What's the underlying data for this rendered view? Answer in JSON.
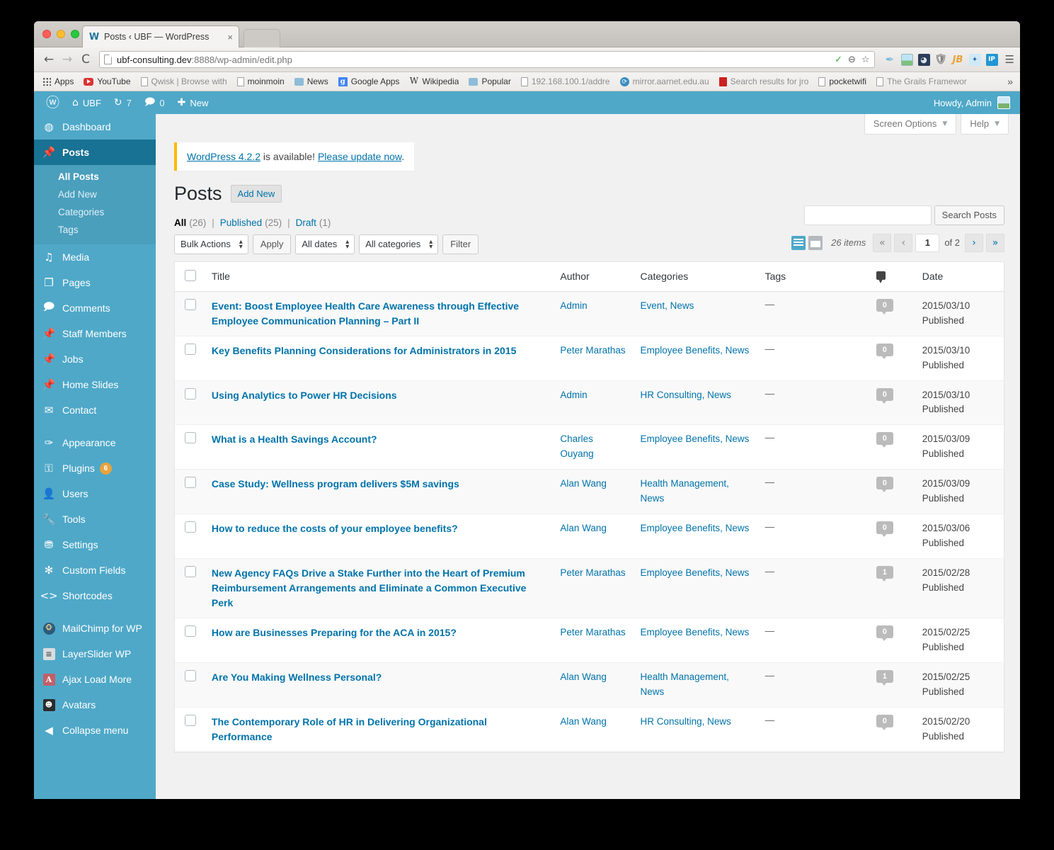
{
  "browser": {
    "tab": {
      "title": "Posts ‹ UBF — WordPress",
      "favicon": "wordpress-icon",
      "close": "×"
    },
    "nav": {
      "back": "←",
      "forward": "→",
      "reload": "C"
    },
    "url": {
      "host": "ubf-consulting.dev",
      "rest": ":8888/wp-admin/edit.php"
    },
    "omnibox_icons": [
      "check-icon",
      "zoom-out-icon",
      "bookmark-star-icon"
    ],
    "extension_icons": [
      "feather-icon",
      "image-icon",
      "speedometer-icon",
      "shield-icon",
      "jb-icon",
      "gear-tag-icon",
      "ip-icon",
      "chrome-menu-icon"
    ],
    "bookmarks": [
      {
        "label": "Apps",
        "icon": "apps-grid-icon"
      },
      {
        "label": "YouTube",
        "icon": "youtube-icon"
      },
      {
        "label": "Qwisk | Browse with",
        "icon": "page-icon"
      },
      {
        "label": "moinmoin",
        "icon": "page-icon"
      },
      {
        "label": "News",
        "icon": "folder-icon"
      },
      {
        "label": "Google Apps",
        "icon": "google-icon"
      },
      {
        "label": "Wikipedia",
        "icon": "wikipedia-icon"
      },
      {
        "label": "Popular",
        "icon": "folder-icon"
      },
      {
        "label": "192.168.100.1/addre",
        "icon": "page-icon"
      },
      {
        "label": "mirror.aarnet.edu.au",
        "icon": "mirror-icon"
      },
      {
        "label": "Search results for jro",
        "icon": "red-icon"
      },
      {
        "label": "pocketwifi",
        "icon": "page-icon"
      },
      {
        "label": "The Grails Framewor",
        "icon": "page-icon"
      }
    ],
    "bookmarks_overflow": "»"
  },
  "adminbar": {
    "logo": "wordpress-logo-icon",
    "site_name": "UBF",
    "site_icon": "home-icon",
    "updates_icon": "updates-icon",
    "updates_count": "7",
    "comments_icon": "comment-icon",
    "comments_count": "0",
    "new_icon": "plus-icon",
    "new_label": "New",
    "howdy": "Howdy, Admin",
    "avatar": "avatar"
  },
  "sidebar": {
    "items": [
      {
        "label": "Dashboard",
        "icon": "dashboard-icon",
        "glyph": "◔"
      },
      {
        "label": "Posts",
        "icon": "pin-icon",
        "glyph": "📌",
        "current": true
      },
      {
        "label": "Media",
        "icon": "media-icon",
        "glyph": "♫"
      },
      {
        "label": "Pages",
        "icon": "pages-icon",
        "glyph": "❐"
      },
      {
        "label": "Comments",
        "icon": "comments-icon",
        "glyph": "🗩"
      },
      {
        "label": "Staff Members",
        "icon": "pin-icon",
        "glyph": "📌"
      },
      {
        "label": "Jobs",
        "icon": "pin-icon",
        "glyph": "📌"
      },
      {
        "label": "Home Slides",
        "icon": "pin-icon",
        "glyph": "📌"
      },
      {
        "label": "Contact",
        "icon": "mail-icon",
        "glyph": "✉"
      },
      {
        "label": "Appearance",
        "icon": "appearance-brush-icon",
        "glyph": "🖌"
      },
      {
        "label": "Plugins",
        "icon": "plugin-icon",
        "glyph": "🔌",
        "badge": "6"
      },
      {
        "label": "Users",
        "icon": "user-icon",
        "glyph": "👤"
      },
      {
        "label": "Tools",
        "icon": "tools-wrench-icon",
        "glyph": "🔧"
      },
      {
        "label": "Settings",
        "icon": "settings-icon",
        "glyph": "⚙"
      },
      {
        "label": "Custom Fields",
        "icon": "gear-icon",
        "glyph": "✾"
      },
      {
        "label": "Shortcodes",
        "icon": "code-icon",
        "glyph": "<>"
      },
      {
        "label": "MailChimp for WP",
        "icon": "mailchimp-icon",
        "glyph": "M"
      },
      {
        "label": "LayerSlider WP",
        "icon": "layerslider-icon",
        "glyph": "≡"
      },
      {
        "label": "Ajax Load More",
        "icon": "ajax-load-more-icon",
        "glyph": "A"
      },
      {
        "label": "Avatars",
        "icon": "avatars-icon",
        "glyph": "☻"
      },
      {
        "label": "Collapse menu",
        "icon": "collapse-icon",
        "glyph": "◀"
      }
    ],
    "posts_submenu": [
      {
        "label": "All Posts",
        "current": true
      },
      {
        "label": "Add New",
        "current": false
      },
      {
        "label": "Categories",
        "current": false
      },
      {
        "label": "Tags",
        "current": false
      }
    ]
  },
  "screen_meta": {
    "screen_options": "Screen Options",
    "help": "Help",
    "caret": "▼"
  },
  "notice": {
    "link1": "WordPress 4.2.2",
    "middle": " is available! ",
    "link2": "Please update now",
    "end": "."
  },
  "page": {
    "title": "Posts",
    "add_new": "Add New"
  },
  "views": [
    {
      "label": "All",
      "count": "(26)",
      "current": true
    },
    {
      "label": "Published",
      "count": "(25)",
      "current": false
    },
    {
      "label": "Draft",
      "count": "(1)",
      "current": false
    }
  ],
  "views_sep": "|",
  "filters": {
    "bulk_actions": "Bulk Actions",
    "apply": "Apply",
    "all_dates": "All dates",
    "all_categories": "All categories",
    "filter": "Filter"
  },
  "search": {
    "value": "",
    "placeholder": "",
    "submit": "Search Posts"
  },
  "pagination": {
    "view_list_icon": "list-view-icon",
    "view_excerpt_icon": "excerpt-view-icon",
    "displaying_num": "26 items",
    "first": "«",
    "prev": "‹",
    "current": "1",
    "of_total": "of 2",
    "next": "›",
    "last": "»"
  },
  "table": {
    "columns": [
      "Title",
      "Author",
      "Categories",
      "Tags",
      "comment-icon",
      "Date"
    ],
    "rows": [
      {
        "title": "Event: Boost Employee Health Care Awareness through Effective Employee Communication Planning – Part II",
        "author": "Admin",
        "categories": "Event, News",
        "tags": "—",
        "comments": "0",
        "date": "2015/03/10",
        "status": "Published"
      },
      {
        "title": "Key Benefits Planning Considerations for Administrators in 2015",
        "author": "Peter Marathas",
        "categories": "Employee Benefits, News",
        "tags": "—",
        "comments": "0",
        "date": "2015/03/10",
        "status": "Published"
      },
      {
        "title": "Using Analytics to Power HR Decisions",
        "author": "Admin",
        "categories": "HR Consulting, News",
        "tags": "—",
        "comments": "0",
        "date": "2015/03/10",
        "status": "Published"
      },
      {
        "title": "What is a Health Savings Account?",
        "author": "Charles Ouyang",
        "categories": "Employee Benefits, News",
        "tags": "—",
        "comments": "0",
        "date": "2015/03/09",
        "status": "Published"
      },
      {
        "title": "Case Study: Wellness program delivers $5M savings",
        "author": "Alan Wang",
        "categories": "Health Management, News",
        "tags": "—",
        "comments": "0",
        "date": "2015/03/09",
        "status": "Published"
      },
      {
        "title": "How to reduce the costs of your employee benefits?",
        "author": "Alan Wang",
        "categories": "Employee Benefits, News",
        "tags": "—",
        "comments": "0",
        "date": "2015/03/06",
        "status": "Published"
      },
      {
        "title": "New Agency FAQs Drive a Stake Further into the Heart of Premium Reimbursement Arrangements and Eliminate a Common Executive Perk",
        "author": "Peter Marathas",
        "categories": "Employee Benefits, News",
        "tags": "—",
        "comments": "1",
        "date": "2015/02/28",
        "status": "Published"
      },
      {
        "title": "How are Businesses Preparing for the ACA in 2015?",
        "author": "Peter Marathas",
        "categories": "Employee Benefits, News",
        "tags": "—",
        "comments": "0",
        "date": "2015/02/25",
        "status": "Published"
      },
      {
        "title": "Are You Making Wellness Personal?",
        "author": "Alan Wang",
        "categories": "Health Management, News",
        "tags": "—",
        "comments": "1",
        "date": "2015/02/25",
        "status": "Published"
      },
      {
        "title": "The Contemporary Role of HR in Delivering Organizational Performance",
        "author": "Alan Wang",
        "categories": "HR Consulting, News",
        "tags": "—",
        "comments": "0",
        "date": "2015/02/20",
        "status": "Published"
      }
    ]
  },
  "colors": {
    "wp_blue": "#4fa8c8",
    "wp_blue_dark": "#187294",
    "link": "#0073aa",
    "notice_accent": "#ffba00",
    "badge_orange": "#e8a33d"
  }
}
